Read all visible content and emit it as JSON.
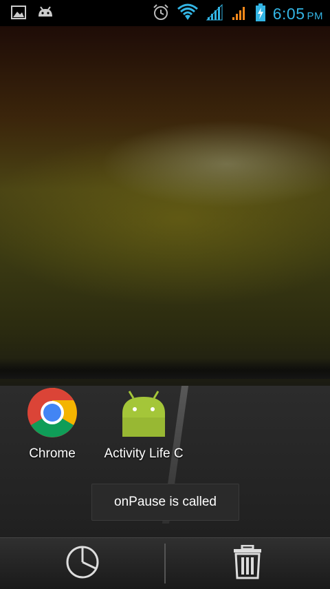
{
  "status_bar": {
    "time": "6:05",
    "ampm": "PM",
    "icons": [
      "gallery-icon",
      "android-debug-icon",
      "alarm-icon",
      "wifi-icon",
      "signal-1-icon",
      "signal-2-icon",
      "battery-charging-icon"
    ]
  },
  "apps": [
    {
      "label": "Chrome",
      "icon": "chrome-icon"
    },
    {
      "label": "Activity Life C",
      "icon": "android-app-icon"
    }
  ],
  "toast": {
    "message": "onPause is called"
  },
  "bottom_bar": {
    "left_icon": "pie-chart-icon",
    "right_icon": "trash-icon"
  },
  "colors": {
    "accent": "#33b5e5",
    "signal_1": "#33b5e5",
    "signal_2": "#ff8a1a",
    "android_green": "#a4c639"
  }
}
